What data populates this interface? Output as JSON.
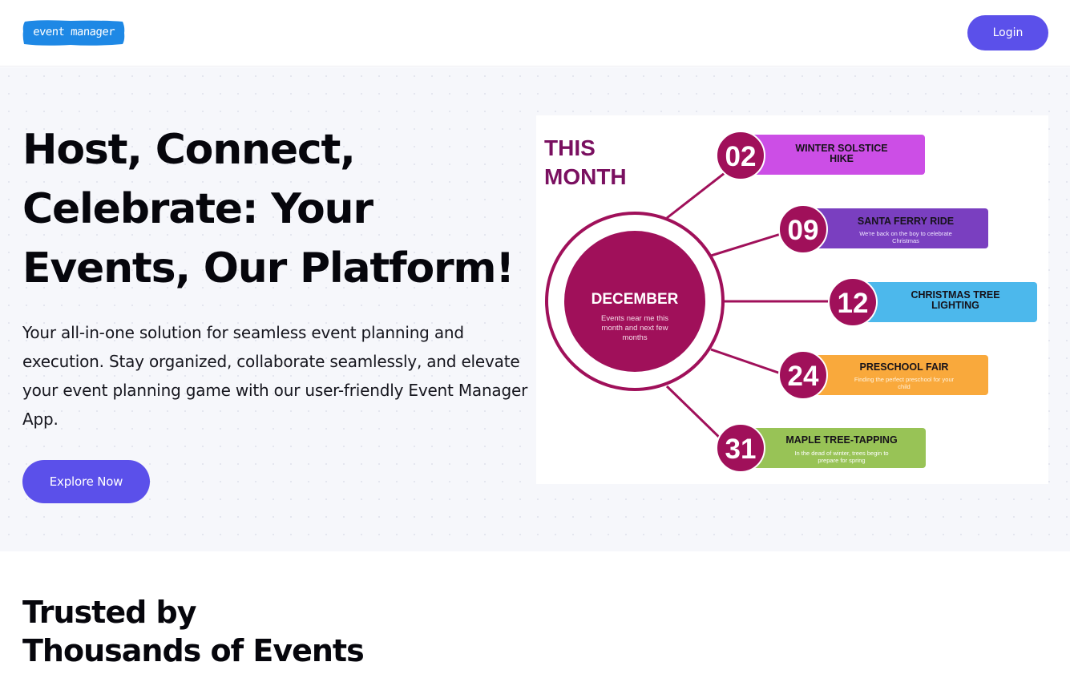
{
  "header": {
    "logo_text": "event manager",
    "login_label": "Login"
  },
  "hero": {
    "title": "Host, Connect, Celebrate: Your Events, Our Platform!",
    "subtitle": "Your all-in-one solution for seamless event planning and execution. Stay organized, collaborate seamlessly, and elevate your event planning game with our user-friendly Event Manager App.",
    "cta_label": "Explore Now"
  },
  "infographic": {
    "heading_line1": "THIS",
    "heading_line2": "MONTH",
    "center_title": "DECEMBER",
    "center_text_line1": "Events near me this",
    "center_text_line2": "month and next few",
    "center_text_line3": "months",
    "events": [
      {
        "day": "02",
        "title_line1": "WINTER SOLSTICE",
        "title_line2": "HIKE",
        "desc_line1": "",
        "desc_line2": "",
        "color": "#cc4ee6"
      },
      {
        "day": "09",
        "title_line1": "SANTA FERRY RIDE",
        "title_line2": "",
        "desc_line1": "We're back on the boy to celebrate",
        "desc_line2": "Christmas",
        "color": "#7a3fc0"
      },
      {
        "day": "12",
        "title_line1": "CHRISTMAS TREE",
        "title_line2": "LIGHTING",
        "desc_line1": "",
        "desc_line2": "",
        "color": "#4cb8ec"
      },
      {
        "day": "24",
        "title_line1": "PRESCHOOL FAIR",
        "title_line2": "",
        "desc_line1": "Finding the perfect preschool for your",
        "desc_line2": "child",
        "color": "#f9a93c"
      },
      {
        "day": "31",
        "title_line1": "MAPLE TREE-TAPPING",
        "title_line2": "",
        "desc_line1": "In the dead of winter, trees begin to",
        "desc_line2": "prepare for spring",
        "color": "#98c356"
      }
    ],
    "accent_color": "#a0105a"
  },
  "trusted": {
    "title_line1": "Trusted by",
    "title_line2": "Thousands of Events"
  },
  "colors": {
    "brand": "#5b50ea",
    "logo_blue": "#1e88e5"
  }
}
